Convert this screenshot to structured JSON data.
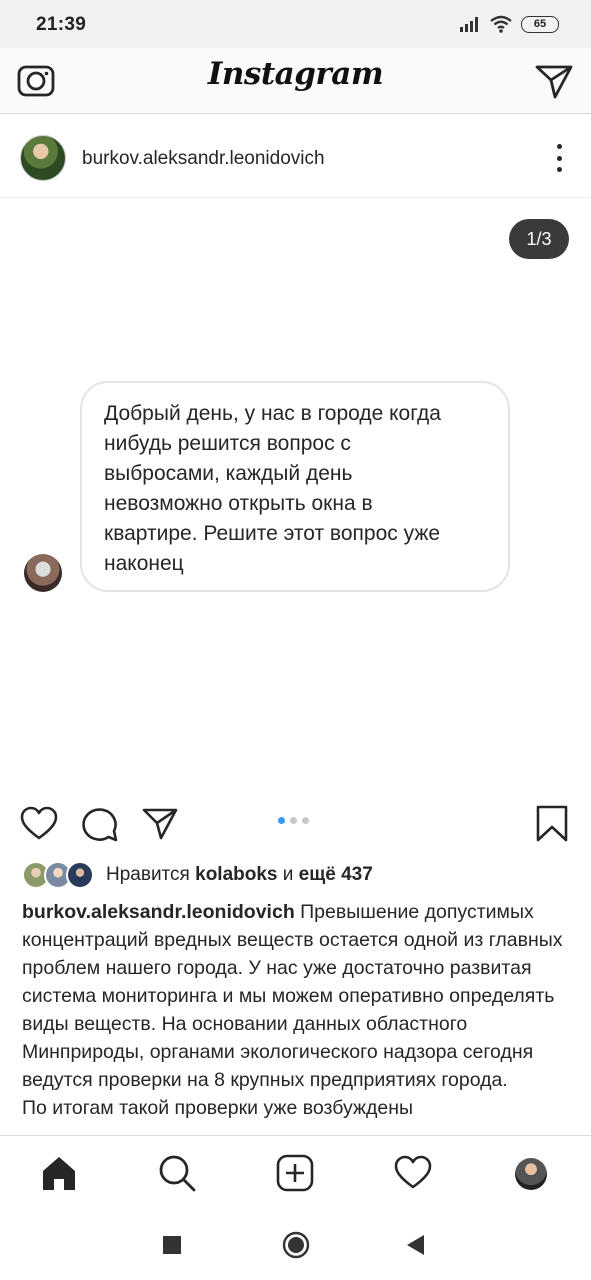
{
  "status_bar": {
    "time": "21:39",
    "battery": "65"
  },
  "header": {
    "logo": "Instagram",
    "camera_icon": "camera-icon",
    "direct_icon": "paper-plane-icon"
  },
  "post": {
    "username": "burkov.aleksandr.leonidovich",
    "media_counter": "1/3",
    "message_text": "Добрый день, у нас в городе когда\nнибудь решится вопрос с\nвыбросами, каждый день\nневозможно открыть окна в\nквартире. Решите этот вопрос уже\nнаконец",
    "carousel": {
      "total": 3,
      "active": 1
    },
    "likes": {
      "prefix": "Нравится ",
      "user": "kolaboks",
      "middle": " и ",
      "count_text": "ещё 437"
    },
    "caption": {
      "username": "burkov.aleksandr.leonidovich",
      "text": " Превышение допустимых концентраций вредных веществ остается одной из главных проблем нашего города. У нас уже достаточно развитая система мониторинга и мы можем оперативно определять виды веществ. На основании данных областного Минприроды, органами экологического надзора сегодня ведутся проверки на 8 крупных предприятиях города.",
      "text_2": "По итогам такой проверки уже возбуждены"
    }
  },
  "tabbar": [
    "home-icon",
    "search-icon",
    "new-post-icon",
    "activity-heart-icon",
    "profile-avatar"
  ],
  "colors": {
    "accent_blue": "#3897f0",
    "text": "#262626",
    "border": "#dbdbdb"
  }
}
